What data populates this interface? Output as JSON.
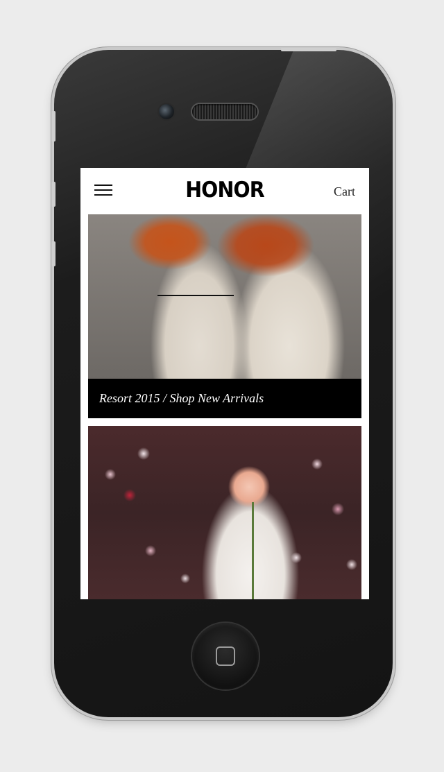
{
  "app": {
    "brand": "HONOR",
    "cart_label": "Cart"
  },
  "feature": {
    "caption": "Resort 2015 / Shop New Arrivals"
  }
}
